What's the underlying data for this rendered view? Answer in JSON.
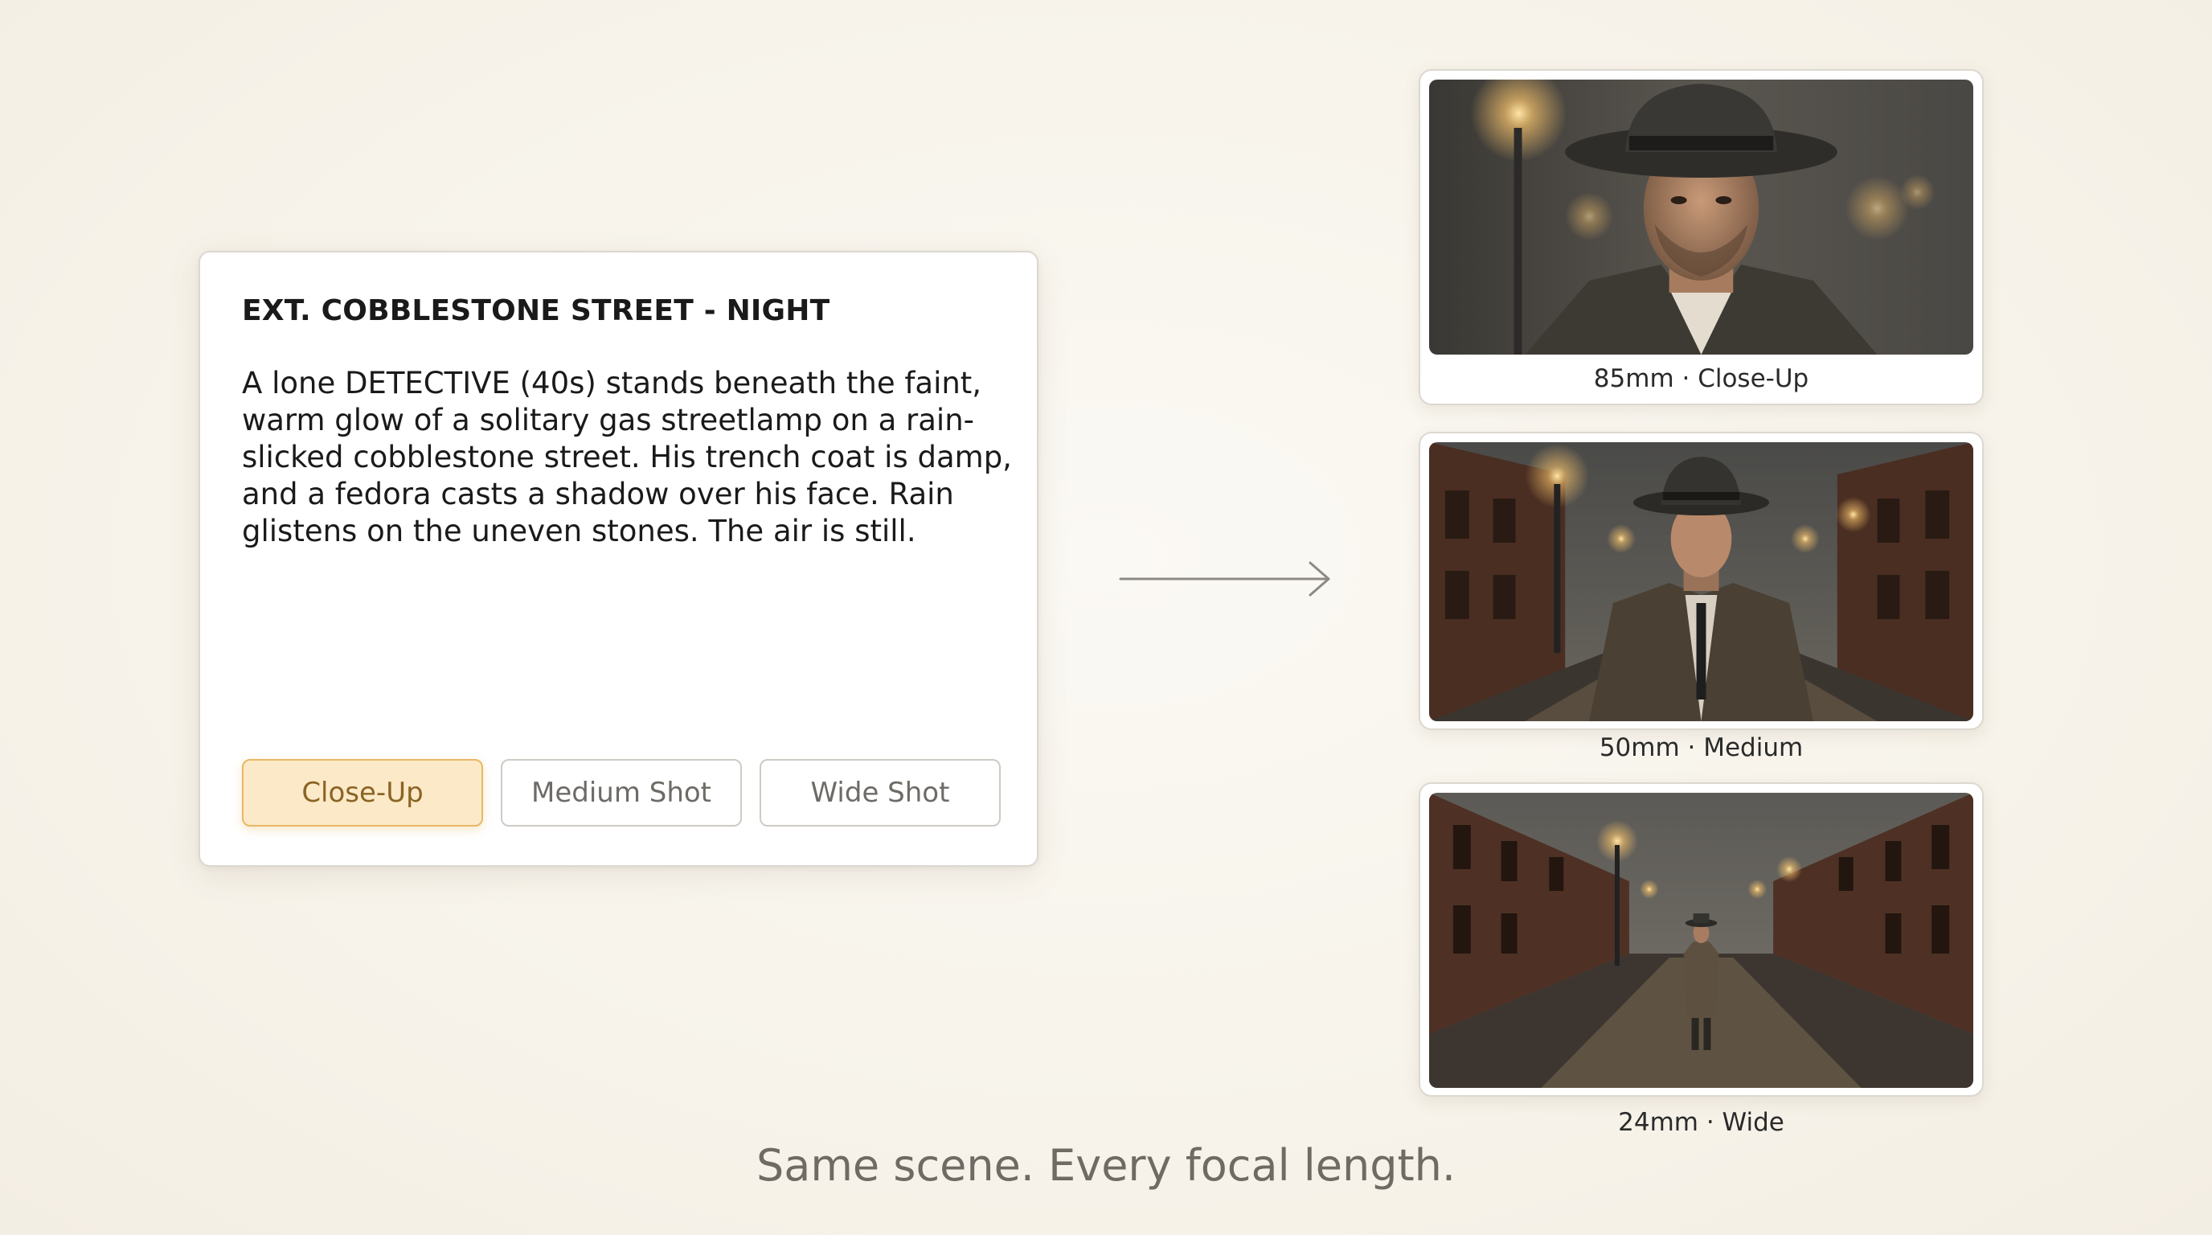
{
  "script": {
    "heading": "EXT. COBBLESTONE STREET - NIGHT",
    "body": "A lone DETECTIVE (40s) stands beneath the faint, warm glow of a solitary gas streetlamp on a rain-slicked cobblestone street. His trench coat is damp, and a fedora casts a shadow over his face. Rain glistens on the uneven stones. The air is still.",
    "buttons": [
      {
        "label": "Close-Up",
        "active": true
      },
      {
        "label": "Medium Shot",
        "active": false
      },
      {
        "label": "Wide Shot",
        "active": false
      }
    ]
  },
  "frames": [
    {
      "caption": "85mm · Close-Up"
    },
    {
      "caption": "50mm · Medium"
    },
    {
      "caption": "24mm · Wide"
    }
  ],
  "tagline": "Same scene. Every focal length.",
  "colors": {
    "accent_bg": "#fce9c7",
    "accent_border": "#e8b866",
    "accent_text": "#8a6424",
    "page_bg": "#f7f3ea"
  },
  "icons": {
    "arrow": "arrow-right-icon"
  }
}
